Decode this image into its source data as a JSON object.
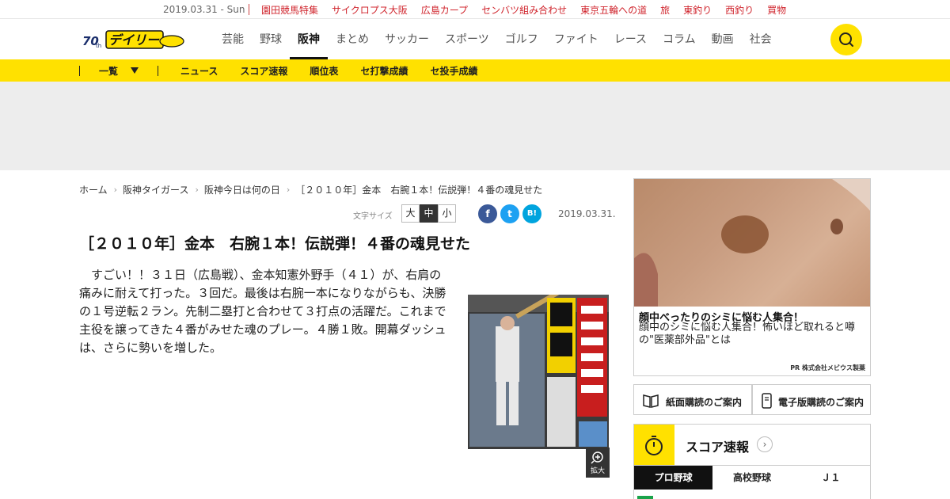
{
  "topbar": {
    "date": "2019.03.31 - Sun",
    "links": [
      "園田競馬特集",
      "サイクロプス大阪",
      "広島カープ",
      "センバツ組み合わせ",
      "東京五輪への道",
      "旅",
      "東釣り",
      "西釣り",
      "買物"
    ]
  },
  "header": {
    "logo_text": "デイリー",
    "nav": [
      "芸能",
      "野球",
      "阪神",
      "まとめ",
      "サッカー",
      "スポーツ",
      "ゴルフ",
      "ファイト",
      "レース",
      "コラム",
      "動画",
      "社会"
    ],
    "active_nav": "阪神"
  },
  "subnav": {
    "dropdown_label": "一覧",
    "links": [
      "ニュース",
      "スコア速報",
      "順位表",
      "セ打撃成績",
      "セ投手成績"
    ]
  },
  "breadcrumb": [
    "ホーム",
    "阪神タイガース",
    "阪神今日は何の日",
    "［２０１０年］金本　右腕１本！伝説弾！４番の魂見せた"
  ],
  "tools": {
    "font_size_label": "文字サイズ",
    "font_sizes": [
      "大",
      "中",
      "小"
    ],
    "selected_size": "中",
    "share": [
      "f",
      "t",
      "B!"
    ],
    "date": "2019.03.31."
  },
  "article": {
    "title": "［２０１０年］金本　右腕１本！伝説弾！４番の魂見せた",
    "body": "すごい！！３１日（広島戦）、金本知憲外野手（４１）が、右肩の痛みに耐えて打った。３回だ。最後は右腕一本になりながらも、決勝の１号逆転２ラン。先制二塁打と合わせて３打点の活躍だ。これまで主役を譲ってきた４番がみせた魂のプレー。４勝１敗。開幕ダッシュは、さらに勢いを増した。",
    "image_label": "拡大"
  },
  "side_ad": {
    "title": "顔中べったりのシミに悩む人集合！",
    "text": "顔中のシミに悩む人集合！怖いほど取れると噂の\"医薬部外品\"とは",
    "pr": "PR 株式会社メビウス製薬"
  },
  "subscribe": {
    "paper": "紙面購読のご案内",
    "digital": "電子版購読のご案内"
  },
  "score": {
    "title": "スコア速報",
    "tabs": [
      "プロ野球",
      "高校野球",
      "Ｊ１"
    ],
    "active_tab": "プロ野球"
  },
  "colors": {
    "brand_yellow": "#ffe100",
    "link_red": "#d0262e",
    "facebook": "#3b5998",
    "twitter": "#1da1f2",
    "hatena": "#00a4de"
  }
}
